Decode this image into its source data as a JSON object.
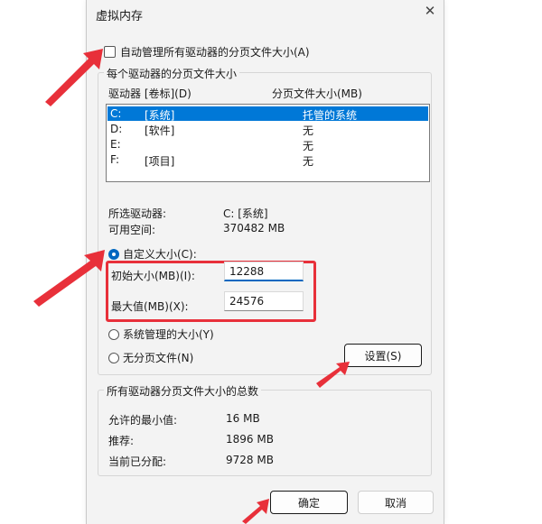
{
  "window": {
    "title": "虚拟内存",
    "close_glyph": "✕"
  },
  "auto_manage": {
    "label": "自动管理所有驱动器的分页文件大小(A)",
    "checked": false
  },
  "per_drive": {
    "group_label": "每个驱动器的分页文件大小",
    "col_drive": "驱动器 [卷标](D)",
    "col_size": "分页文件大小(MB)",
    "drives": [
      {
        "letter": "C:",
        "label": "[系统]",
        "size": "托管的系统",
        "selected": true
      },
      {
        "letter": "D:",
        "label": "[软件]",
        "size": "无",
        "selected": false
      },
      {
        "letter": "E:",
        "label": "",
        "size": "无",
        "selected": false
      },
      {
        "letter": "F:",
        "label": "[项目]",
        "size": "无",
        "selected": false
      }
    ],
    "selected_drive_label": "所选驱动器:",
    "selected_drive_value": "C:  [系统]",
    "free_space_label": "可用空间:",
    "free_space_value": "370482 MB",
    "custom_size": {
      "label": "自定义大小(C):",
      "checked": true
    },
    "initial_size": {
      "label": "初始大小(MB)(I):",
      "value": "12288"
    },
    "max_size": {
      "label": "最大值(MB)(X):",
      "value": "24576"
    },
    "system_managed": {
      "label": "系统管理的大小(Y)",
      "checked": false
    },
    "no_paging": {
      "label": "无分页文件(N)",
      "checked": false
    },
    "set_button": "设置(S)"
  },
  "totals": {
    "group_label": "所有驱动器分页文件大小的总数",
    "min_label": "允许的最小值:",
    "min_value": "16 MB",
    "recommended_label": "推荐:",
    "recommended_value": "1896 MB",
    "allocated_label": "当前已分配:",
    "allocated_value": "9728 MB"
  },
  "buttons": {
    "ok": "确定",
    "cancel": "取消"
  },
  "colors": {
    "annotation": "#e8303a",
    "selection": "#0078d7",
    "accent": "#0067c0"
  }
}
